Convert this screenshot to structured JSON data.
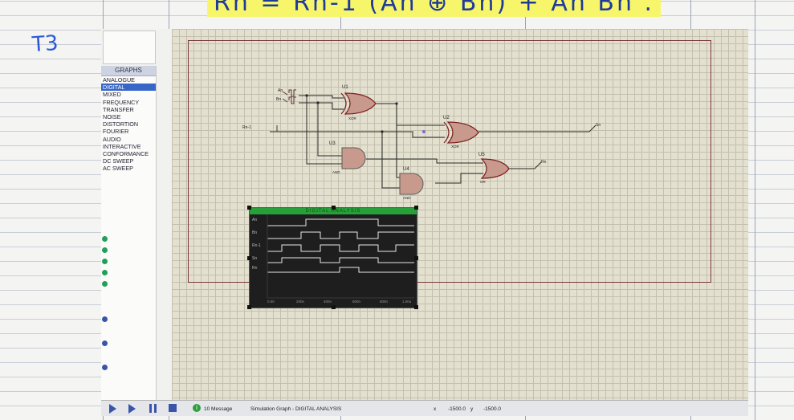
{
  "paper": {
    "handwritten_equation": "Rn = Rn-1 (An ⊕ Bn) + An Bn .",
    "margin_note": "T3"
  },
  "graphs_panel": {
    "title": "GRAPHS",
    "items": [
      "ANALOGUE",
      "DIGITAL",
      "MIXED",
      "FREQUENCY",
      "TRANSFER",
      "NOISE",
      "DISTORTION",
      "FOURIER",
      "AUDIO",
      "INTERACTIVE",
      "CONFORMANCE",
      "DC SWEEP",
      "AC SWEEP"
    ],
    "selected": "DIGITAL"
  },
  "schematic": {
    "inputs": [
      "An",
      "Bn",
      "Rn-1"
    ],
    "gates": [
      {
        "ref": "U1",
        "type": "XOR"
      },
      {
        "ref": "U2",
        "type": "XOR"
      },
      {
        "ref": "U3",
        "type": "AND"
      },
      {
        "ref": "U4",
        "type": "AND"
      },
      {
        "ref": "U5",
        "type": "OR"
      }
    ],
    "outputs": [
      "Sn",
      "Rn"
    ]
  },
  "graph": {
    "title": "DIGITAL ANALYSIS",
    "traces": [
      "An",
      "Bn",
      "Rn-1",
      "Sn",
      "Rn"
    ],
    "x_ticks": [
      "0.00",
      "200n",
      "400n",
      "600n",
      "800n",
      "1.00u"
    ]
  },
  "status_bar": {
    "messages": "10 Message",
    "graph_info": "Simulation Graph - DIGITAL ANALYSIS",
    "x_label": "x",
    "x_value": "-1500.0",
    "y_label": "y",
    "y_value": "-1500.0"
  },
  "colors": {
    "wire": "#2a2a2a",
    "gate_fill": "#c89a8e",
    "gate_stroke": "#7a1f1f",
    "trace": "#e8e8e8",
    "graph_title": "#28a03a",
    "selection": "#3866c8"
  }
}
